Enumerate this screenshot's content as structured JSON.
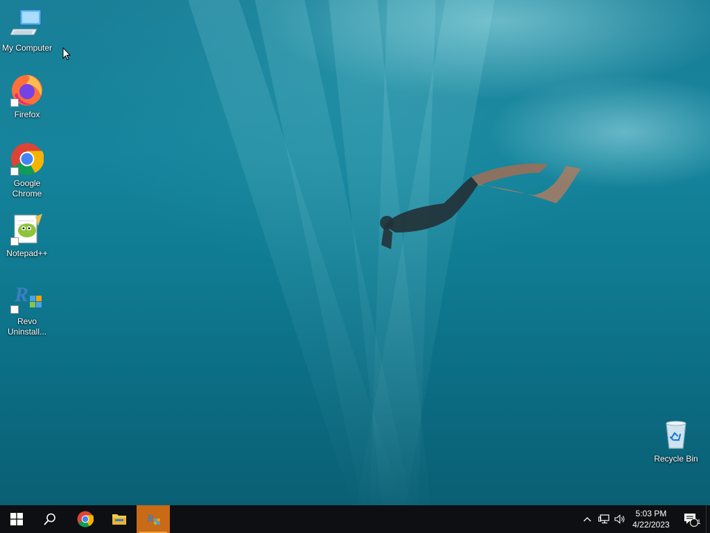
{
  "desktop": {
    "icons": [
      {
        "label": "My Computer",
        "icon": "computer-icon",
        "shortcut": false
      },
      {
        "label": "Firefox",
        "icon": "firefox-icon",
        "shortcut": true
      },
      {
        "label": "Google Chrome",
        "icon": "chrome-icon",
        "shortcut": true
      },
      {
        "label": "Notepad++",
        "icon": "notepadpp-icon",
        "shortcut": true
      },
      {
        "label": "Revo Uninstall...",
        "icon": "revo-uninstaller-icon",
        "shortcut": true
      },
      {
        "label": "Recycle Bin",
        "icon": "recycle-bin-icon",
        "shortcut": false
      }
    ]
  },
  "taskbar": {
    "buttons": [
      {
        "name": "start",
        "icon": "windows-logo-icon"
      },
      {
        "name": "search",
        "icon": "search-icon"
      },
      {
        "name": "chrome",
        "icon": "chrome-icon"
      },
      {
        "name": "file-explorer",
        "icon": "folder-icon"
      },
      {
        "name": "revo-uninstaller",
        "icon": "revo-uninstaller-icon",
        "active": true
      }
    ],
    "tray": {
      "icons": [
        "chevron-up-icon",
        "network-icon",
        "speaker-icon"
      ],
      "time": "5:03 PM",
      "date": "4/22/2023",
      "notification_count": "1"
    }
  },
  "colors": {
    "taskbar_bg": "#0d0f12",
    "active_app_bg": "#c96a17",
    "water": "#127a92"
  }
}
